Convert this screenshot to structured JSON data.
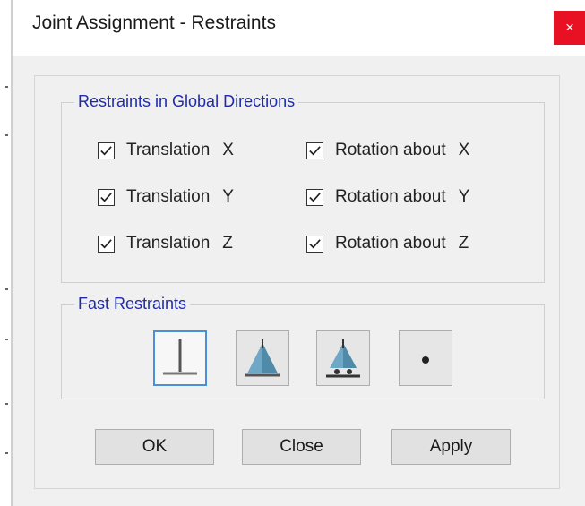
{
  "window": {
    "title": "Joint Assignment - Restraints",
    "close_glyph": "×",
    "close_color": "#e81123"
  },
  "restraints_group": {
    "label": "Restraints in Global Directions",
    "items": [
      {
        "label": "Translation",
        "axis": "X",
        "checked": true
      },
      {
        "label": "Translation",
        "axis": "Y",
        "checked": true
      },
      {
        "label": "Translation",
        "axis": "Z",
        "checked": true
      },
      {
        "label": "Rotation about",
        "axis": "X",
        "checked": true
      },
      {
        "label": "Rotation about",
        "axis": "Y",
        "checked": true
      },
      {
        "label": "Rotation about",
        "axis": "Z",
        "checked": true
      }
    ]
  },
  "fast_restraints": {
    "label": "Fast Restraints",
    "buttons": [
      {
        "icon": "fixed-support-icon",
        "selected": true
      },
      {
        "icon": "pinned-support-icon",
        "selected": false
      },
      {
        "icon": "roller-support-icon",
        "selected": false
      },
      {
        "icon": "free-joint-icon",
        "selected": false
      }
    ]
  },
  "buttons": {
    "ok": "OK",
    "close": "Close",
    "apply": "Apply"
  },
  "colors": {
    "group_label": "#1e2ab0",
    "selected_border": "#4a90d9",
    "cone": "#6fa8c7"
  }
}
